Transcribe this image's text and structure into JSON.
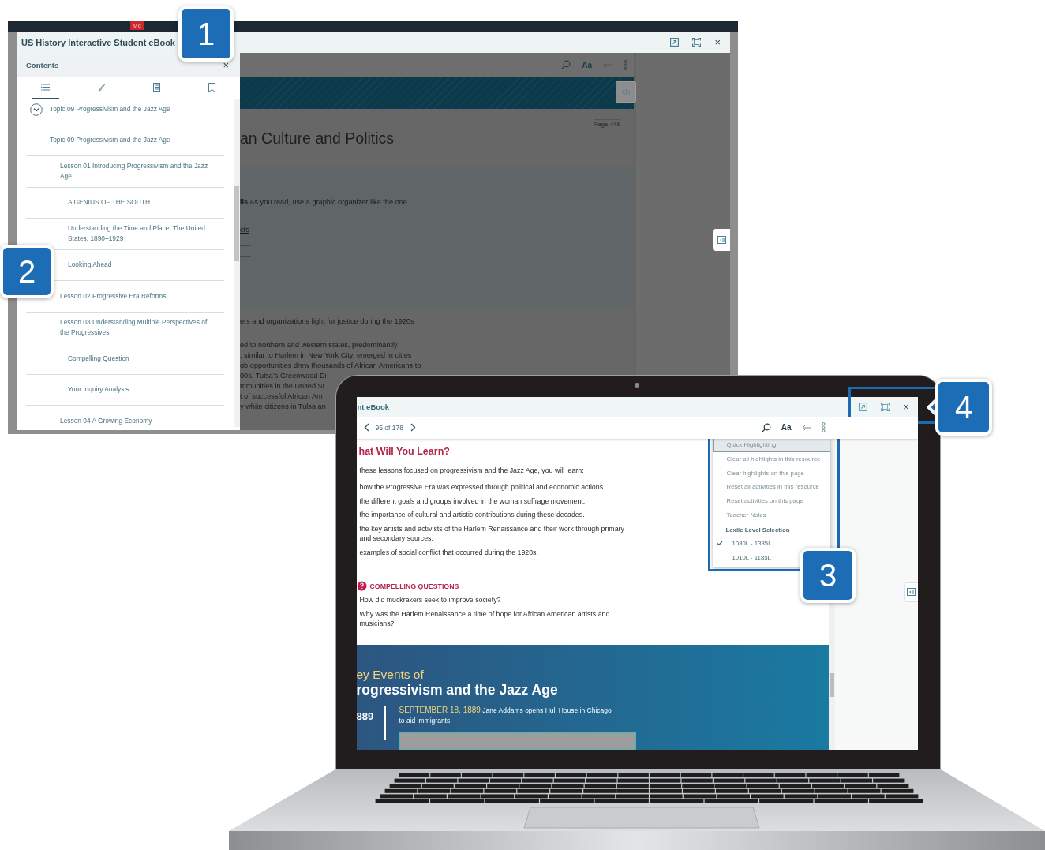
{
  "callouts": [
    {
      "number": "1"
    },
    {
      "number": "2"
    },
    {
      "number": "3"
    },
    {
      "number": "4"
    }
  ],
  "back_window": {
    "browser_badge": "Mc",
    "title": "US History Interactive Student eBook",
    "close": "×",
    "sidebar": {
      "title": "Contents",
      "close": "×",
      "tabs": [
        {
          "kind": "list",
          "selected": true
        },
        {
          "kind": "pen",
          "selected": false
        },
        {
          "kind": "notes",
          "selected": false
        },
        {
          "kind": "bookmark",
          "selected": false
        }
      ],
      "toc": [
        {
          "label": "Topic 09 Progressivism and the Jazz Age",
          "expanded": true,
          "children": [
            {
              "label": "Topic 09 Progressivism and the Jazz Age",
              "children": [
                {
                  "label": "Lesson 01 Introducing Progressivism and the Jazz Age",
                  "children": [
                    {
                      "label": "A GENIUS OF THE SOUTH"
                    },
                    {
                      "label": "Understanding the Time and Place: The United States, 1890–1929"
                    },
                    {
                      "label": "Looking Ahead"
                    }
                  ]
                },
                {
                  "label": "Lesson 02 Progressive Era Reforms"
                },
                {
                  "label": "Lesson 03 Understanding Multiple Perspectives of the Progressives",
                  "children": [
                    {
                      "label": "Compelling Question"
                    },
                    {
                      "label": "Your Inquiry Analysis"
                    }
                  ]
                },
                {
                  "label": "Lesson 04 A Growing Economy"
                }
              ]
            }
          ]
        }
      ]
    },
    "toolbar": {
      "font_button": "Aa"
    },
    "page": {
      "page_label": "Page 449",
      "heading": "an Culture and Politics",
      "intro": "**ils** As you read, use a graphic organizer like the one",
      "organizer_label": "cts",
      "subheading": "ers and organizations fight for justice during the 1920s",
      "lines": [
        "ed to northern and western states, predominantly",
        ", similar to Harlem in New York City, emerged in cities",
        "ob opportunities drew thousands of African Americans to",
        "00s. Tulsa’s Greenwood Di",
        "mmunities in the United St",
        "t of successful African Am",
        "y white citizens in Tulsa an"
      ]
    }
  },
  "laptop": {
    "title": "nt eBook",
    "close": "×",
    "page_count": "95 of 178",
    "toolbar": {
      "font_button": "Aa"
    },
    "menu": {
      "items": [
        {
          "label": "Quick Highlighting",
          "selected": true
        },
        {
          "label": "Clear all highlights in this resource",
          "selected": false
        },
        {
          "label": "Clear highlights on this page",
          "selected": false
        },
        {
          "label": "Reset all activities in this resource",
          "selected": false
        },
        {
          "label": "Reset activities on this page",
          "selected": false
        },
        {
          "label": "Teacher Notes",
          "selected": false
        }
      ],
      "section": "Lexile Level Selection",
      "options": [
        {
          "label": "1080L - 1335L",
          "checked": true
        },
        {
          "label": "1010L - 1185L",
          "checked": false
        }
      ]
    },
    "content": {
      "heading": "hat Will You Learn?",
      "intro": "these lessons focused on progressivism and the Jazz Age, you will learn:",
      "objectives": [
        "how the Progressive Era was expressed through political and economic actions.",
        "the different goals and groups involved in the woman suffrage movement.",
        "the importance of cultural and artistic contributions during these decades.",
        "the key artists and activists of the Harlem Renaissance and their work through primary and secondary sources.",
        "examples of social conflict that occurred during the 1920s."
      ],
      "questions_title": "COMPELLING QUESTIONS",
      "questions": [
        "How did muckrakers seek to improve society?",
        "Why was the Harlem Renaissance a time of hope for African American artists and musicians?"
      ]
    },
    "banner": {
      "title_line_1": "ey Events of",
      "title_line_2": "rogressivism and the Jazz Age",
      "year": "889",
      "event_date": "SEPTEMBER 18, 1889",
      "event_text": "Jane Addams opens Hull House in Chicago to aid immigrants"
    }
  }
}
